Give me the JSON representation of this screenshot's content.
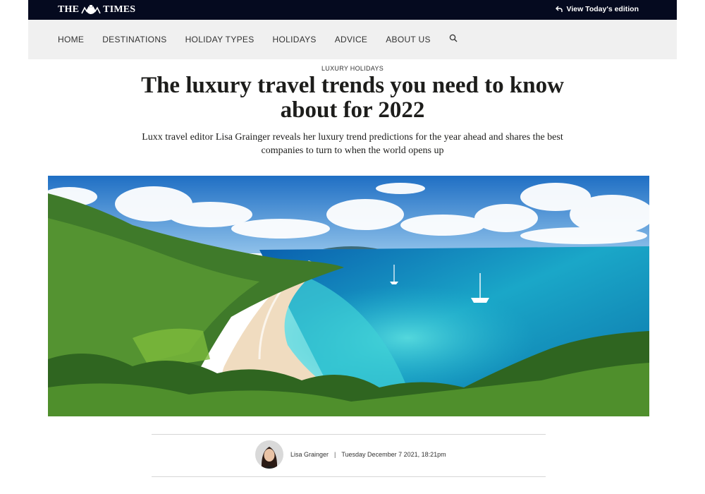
{
  "masthead": {
    "logo_left": "THE",
    "logo_right": "TIMES",
    "edition_label": "View Today's edition"
  },
  "nav": {
    "items": [
      "HOME",
      "DESTINATIONS",
      "HOLIDAY TYPES",
      "HOLIDAYS",
      "ADVICE",
      "ABOUT US"
    ],
    "search_icon": "search-icon"
  },
  "article": {
    "kicker": "LUXURY HOLIDAYS",
    "headline": "The luxury travel trends you need to know about for 2022",
    "standfirst": "Luxx travel editor Lisa Grainger reveals her luxury trend predictions for the year ahead and shares the best companies to turn to when the world opens up",
    "hero_image": "tropical beach bay with turquoise sea and two yachts"
  },
  "byline": {
    "author": "Lisa Grainger",
    "separator": "|",
    "date": "Tuesday December 7 2021, 18:21pm"
  },
  "colors": {
    "masthead": "#050a1f",
    "nav_background": "#f0f0f0",
    "text": "#1d1d1b"
  }
}
